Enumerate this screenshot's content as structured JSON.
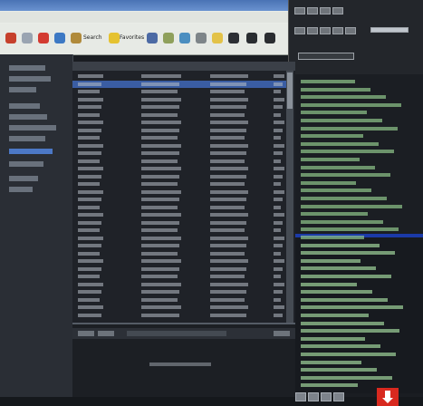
{
  "browser": {
    "toolbar": {
      "search_label": "Search",
      "favorites_label": "Favorites"
    }
  },
  "colors": {
    "accent_blue": "#1b3aa8",
    "list_green": "#8ec48a",
    "download_red": "#d8291f"
  },
  "icons": [
    "back-icon",
    "forward-icon",
    "stop-icon",
    "refresh-icon",
    "home-icon",
    "search-icon",
    "favorites-icon",
    "media-icon",
    "history-icon",
    "mail-icon",
    "print-icon",
    "edit-icon",
    "discuss-icon",
    "messenger-icon",
    "player-play-icon",
    "player-stop-icon",
    "download-icon"
  ]
}
